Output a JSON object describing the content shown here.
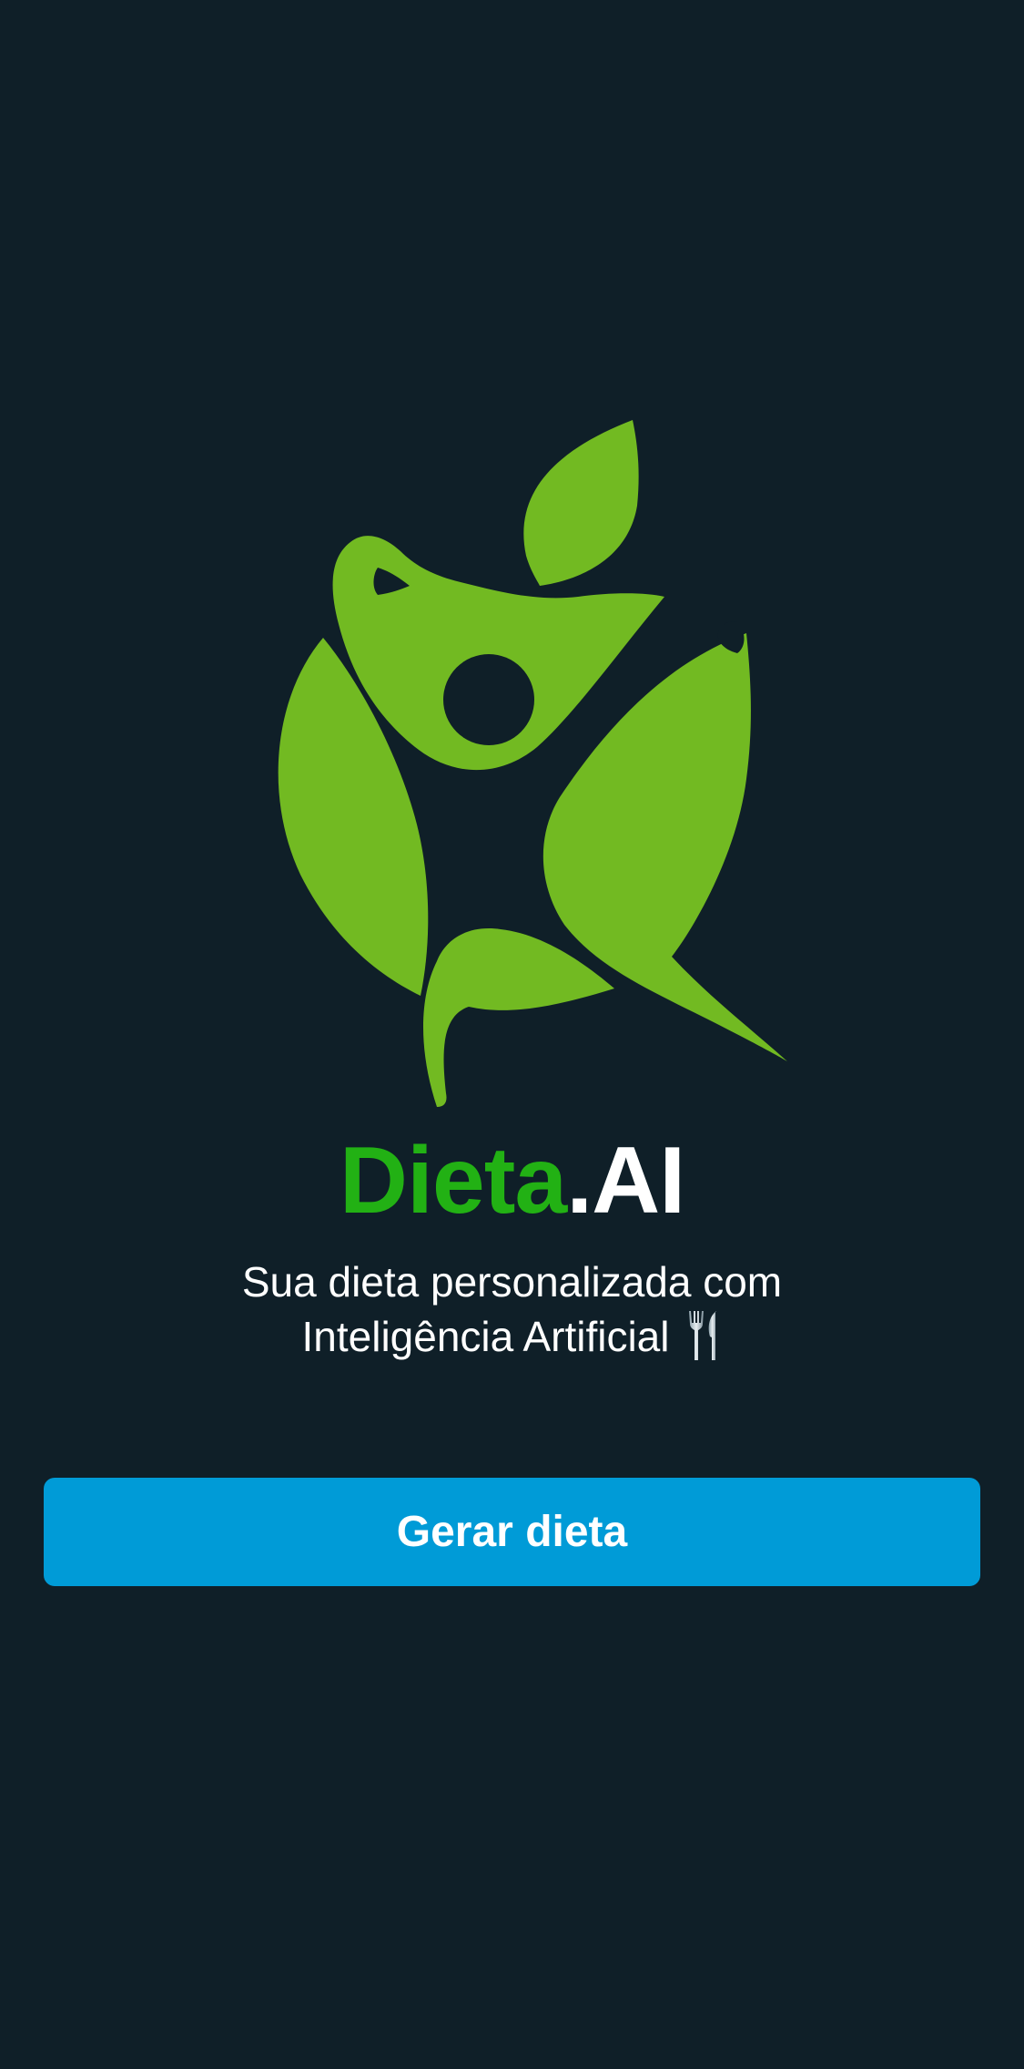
{
  "app": {
    "brand_primary": "Dieta",
    "brand_secondary": ".AI",
    "brand_primary_color": "#22b114",
    "brand_secondary_color": "#ffffff",
    "background_color": "#0f1f28",
    "logo_icon": "apple-person-leaf-logo",
    "logo_color": "#72ba22"
  },
  "tagline": {
    "line1": "Sua dieta personalizada com",
    "line2": "Inteligência Artificial",
    "emoji_icon": "fork-and-knife-icon"
  },
  "cta": {
    "label": "Gerar dieta",
    "color": "#009bd7"
  }
}
